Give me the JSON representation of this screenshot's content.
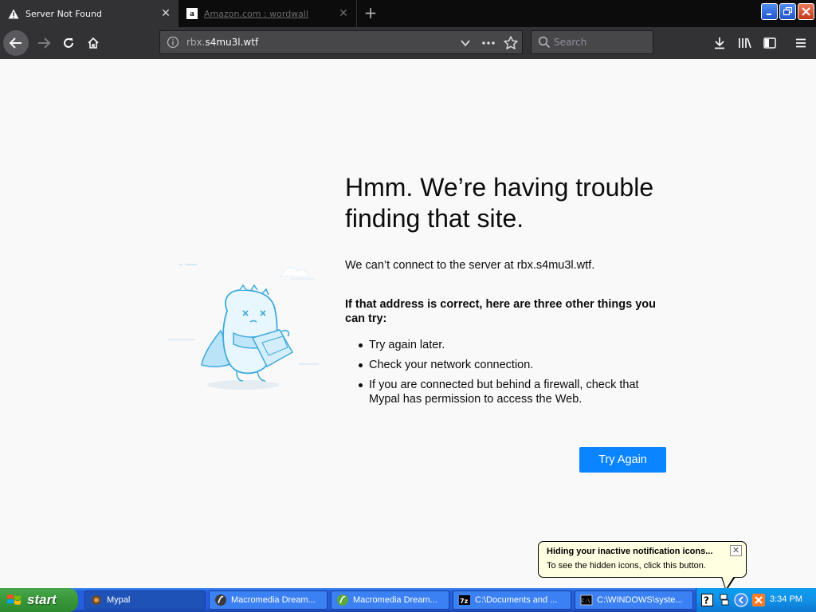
{
  "browser": {
    "tabs": [
      {
        "title": "Server Not Found",
        "active": true
      },
      {
        "title": "Amazon.com : wordwall",
        "active": false
      }
    ],
    "url": {
      "prefix": "rbx.",
      "domain": "s4mu3l.wtf"
    },
    "search": {
      "placeholder": "Search"
    }
  },
  "error_page": {
    "title": "Hmm. We’re having trouble finding that site.",
    "description": "We can’t connect to the server at rbx.s4mu3l.wtf.",
    "subheading": "If that address is correct, here are three other things you can try:",
    "suggestions": [
      "Try again later.",
      "Check your network connection.",
      "If you are connected but behind a firewall, check that Mypal has permission to access the Web."
    ],
    "try_again_label": "Try Again"
  },
  "balloon": {
    "title": "Hiding your inactive notification icons...",
    "text": "To see the hidden icons, click this button."
  },
  "taskbar": {
    "start_label": "start",
    "tasks": [
      {
        "label": "Mypal",
        "icon": "mypal-icon"
      },
      {
        "label": "Macromedia Dream...",
        "icon": "dreamweaver-icon"
      },
      {
        "label": "Macromedia Dream...",
        "icon": "dreamweaver-icon"
      },
      {
        "label": "C:\\Documents and ...",
        "icon": "7zip-icon"
      },
      {
        "label": "C:\\WINDOWS\\syste...",
        "icon": "cmd-icon"
      }
    ],
    "clock": "3:34 PM"
  },
  "colors": {
    "accent": "#0a84ff",
    "toolbar": "#323234",
    "tabstrip": "#0c0c0d",
    "taskbar": "#245edb",
    "start": "#3a9a3c"
  }
}
